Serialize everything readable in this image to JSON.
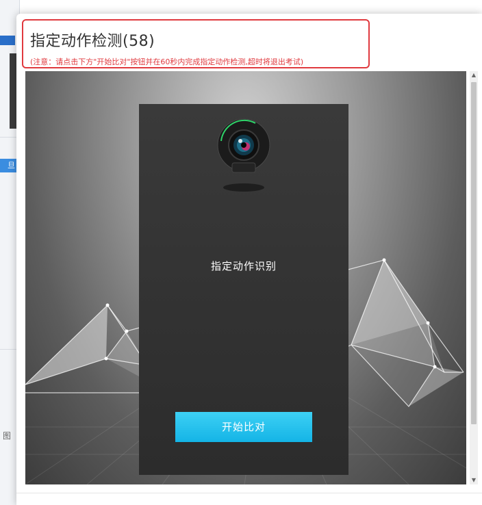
{
  "modal": {
    "title": "指定动作检测(58)",
    "notice": "(注意：请点击下方\"开始比对\"按钮并在60秒内完成指定动作检测,超时将退出考试)"
  },
  "panel": {
    "label": "指定动作识别",
    "start_button": "开始比对",
    "camera_icon": "webcam-icon"
  },
  "background": {
    "button_fragment": "旦",
    "char_fragment": "图"
  },
  "colors": {
    "notice_red": "#e0393e",
    "button_cyan": "#1fc0ee",
    "panel_dark": "#333333"
  }
}
